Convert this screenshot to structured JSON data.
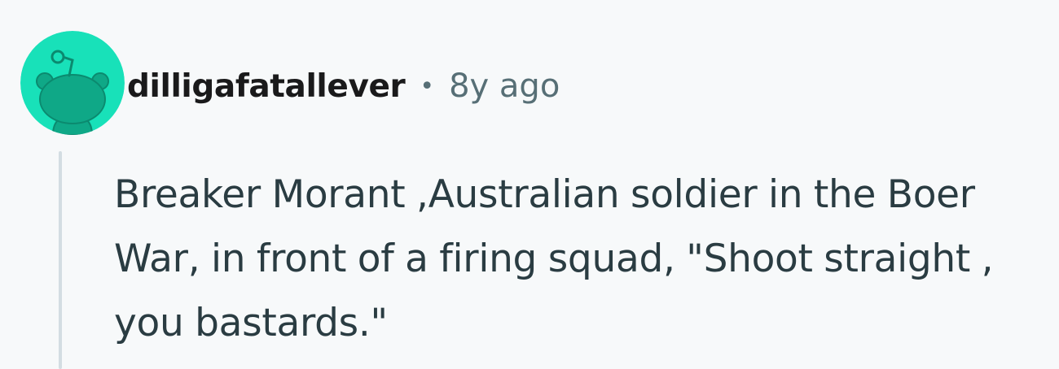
{
  "comment": {
    "username": "dilligafatallever",
    "separator": "•",
    "age": "8y ago",
    "body": "Breaker Morant ,Australian soldier in the Boer War, in front of a firing squad, \"Shoot straight , you bastards.\""
  },
  "avatar": {
    "icon": "reddit-snoo-avatar-icon",
    "background_color": "#18e1b9",
    "figure_color": "#0fa887"
  },
  "colors": {
    "page_background": "#f7f9fa",
    "username": "#1a1a1b",
    "meta": "#576f76",
    "body_text": "#2a3c42",
    "thread_line": "#d3dde2"
  }
}
